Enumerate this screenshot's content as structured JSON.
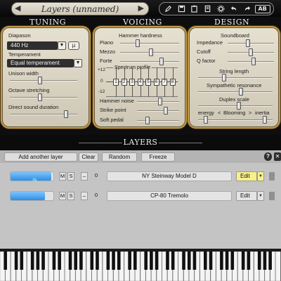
{
  "app": {
    "preset_name": "Layers (unnamed)",
    "prev_arrow": "◀",
    "next_arrow": "▶"
  },
  "toolbar": {
    "icons": [
      "pencil-icon",
      "save-icon",
      "clipboard-icon",
      "page-icon",
      "settings-gear-icon",
      "undo-icon",
      "redo-icon"
    ],
    "ab_label": "AB"
  },
  "sections": {
    "tuning": "TUNING",
    "voicing": "VOICING",
    "design": "DESIGN",
    "layers": "LAYERS"
  },
  "tuning": {
    "diapason_label": "Diapason",
    "diapason_value": "440 Hz",
    "mu_label": "μ",
    "temperament_label": "Temperament",
    "temperament_value": "Equal temperament",
    "sliders": [
      {
        "label": "Unison width",
        "value": 0.45
      },
      {
        "label": "Octave stretching",
        "value": 0.45
      },
      {
        "label": "Direct sound duration",
        "value": 0.83
      }
    ]
  },
  "voicing": {
    "hardness_label": "Hammer hardness",
    "hardness_sliders": [
      {
        "label": "Piano",
        "value": 0.3
      },
      {
        "label": "Mezzo",
        "value": 0.52
      },
      {
        "label": "Forte",
        "value": 0.7
      }
    ],
    "spectrum_label": "Spectrum profile",
    "spectrum_axis": [
      "+12",
      "0",
      "-12"
    ],
    "spectrum_bands": [
      "1",
      "2",
      "3",
      "4",
      "5",
      "6",
      "7",
      "8"
    ],
    "bottom_sliders": [
      {
        "label": "Hammer noise",
        "value": 0.55
      },
      {
        "label": "Strike point",
        "value": 0.68
      },
      {
        "label": "Soft pedal",
        "value": 0.25
      }
    ]
  },
  "design": {
    "soundboard_label": "Soundboard",
    "soundboard_sliders": [
      {
        "label": "Impedance",
        "value": 0.44
      },
      {
        "label": "Cutoff",
        "value": 0.5
      },
      {
        "label": "Q factor",
        "value": 0.56
      }
    ],
    "string_length_label": "String length",
    "string_length": 0.35,
    "sympathetic_label": "Sympathetic resonance",
    "sympathetic": 0.58,
    "duplex_label": "Duplex scale",
    "duplex": 0.55,
    "blooming_left": "energy",
    "blooming_mid": "Blooming",
    "blooming_right": "inertia",
    "blooming_arrow_left": "<",
    "blooming_arrow_right": ">",
    "energy": 0.1,
    "inertia": 0.9
  },
  "layers": {
    "add_label": "Add another layer",
    "clear_label": "Clear",
    "random_label": "Random",
    "freeze_label": "Freeze",
    "help_label": "?",
    "close_label": "✕",
    "rows": [
      {
        "level": 0.95,
        "level_text": "-%",
        "m": "M",
        "s": "S",
        "minus": "–",
        "zero": "0",
        "name": "NY Steinway Model D",
        "edit": "Edit",
        "edit_color": "#f6f08a",
        "selected": true
      },
      {
        "level": 0.8,
        "level_text": "",
        "m": "M",
        "s": "S",
        "minus": "–",
        "zero": "0",
        "name": "CP-80 Tremolo",
        "edit": "Edit",
        "edit_color": "#e4e4e4",
        "selected": false
      }
    ]
  },
  "colors": {
    "panel": "#e0d9c8",
    "panel_border": "#c39a4b",
    "level_blue": "#2f8fe0",
    "edit_highlight": "#f6f08a"
  }
}
